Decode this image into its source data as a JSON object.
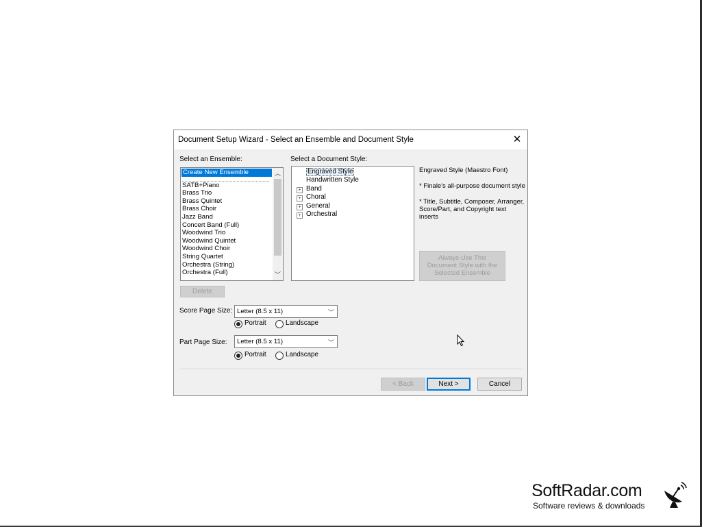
{
  "dialog": {
    "title": "Document Setup Wizard - Select an Ensemble and Document Style",
    "close_icon": "close-icon"
  },
  "ensemble": {
    "label": "Select an Ensemble:",
    "items": [
      "Create New Ensemble",
      "SATB+Piano",
      "Brass Trio",
      "Brass Quintet",
      "Brass Choir",
      "Jazz Band",
      "Concert Band (Full)",
      "Woodwind Trio",
      "Woodwind Quintet",
      "Woodwind Choir",
      "String Quartet",
      "Orchestra (String)",
      "Orchestra (Full)"
    ],
    "selected": "Create New Ensemble",
    "delete_label": "Delete"
  },
  "style": {
    "label": "Select a Document Style:",
    "items": [
      {
        "label": "Engraved Style",
        "expandable": false,
        "selected": true
      },
      {
        "label": "Handwritten Style",
        "expandable": false,
        "selected": false
      },
      {
        "label": "Band",
        "expandable": true,
        "selected": false
      },
      {
        "label": "Choral",
        "expandable": true,
        "selected": false
      },
      {
        "label": "General",
        "expandable": true,
        "selected": false
      },
      {
        "label": "Orchestral",
        "expandable": true,
        "selected": false
      }
    ]
  },
  "description": {
    "heading": "Engraved Style (Maestro Font)",
    "line1": "* Finale's all-purpose document style",
    "line2": "* Title, Subtitle, Composer, Arranger, Score/Part, and Copyright text inserts",
    "always_use_label": "Always Use This Document Style with the Selected Ensemble"
  },
  "score_page": {
    "label": "Score Page Size:",
    "value": "Letter (8.5 x 11)",
    "portrait": "Portrait",
    "landscape": "Landscape",
    "orientation": "Portrait"
  },
  "part_page": {
    "label": "Part Page Size:",
    "value": "Letter (8.5 x 11)",
    "portrait": "Portrait",
    "landscape": "Landscape",
    "orientation": "Portrait"
  },
  "buttons": {
    "back": "< Back",
    "next": "Next >",
    "cancel": "Cancel"
  },
  "watermark": {
    "brand": "SoftRadar.com",
    "tagline": "Software reviews & downloads",
    "icon": "satellite-dish-icon"
  }
}
